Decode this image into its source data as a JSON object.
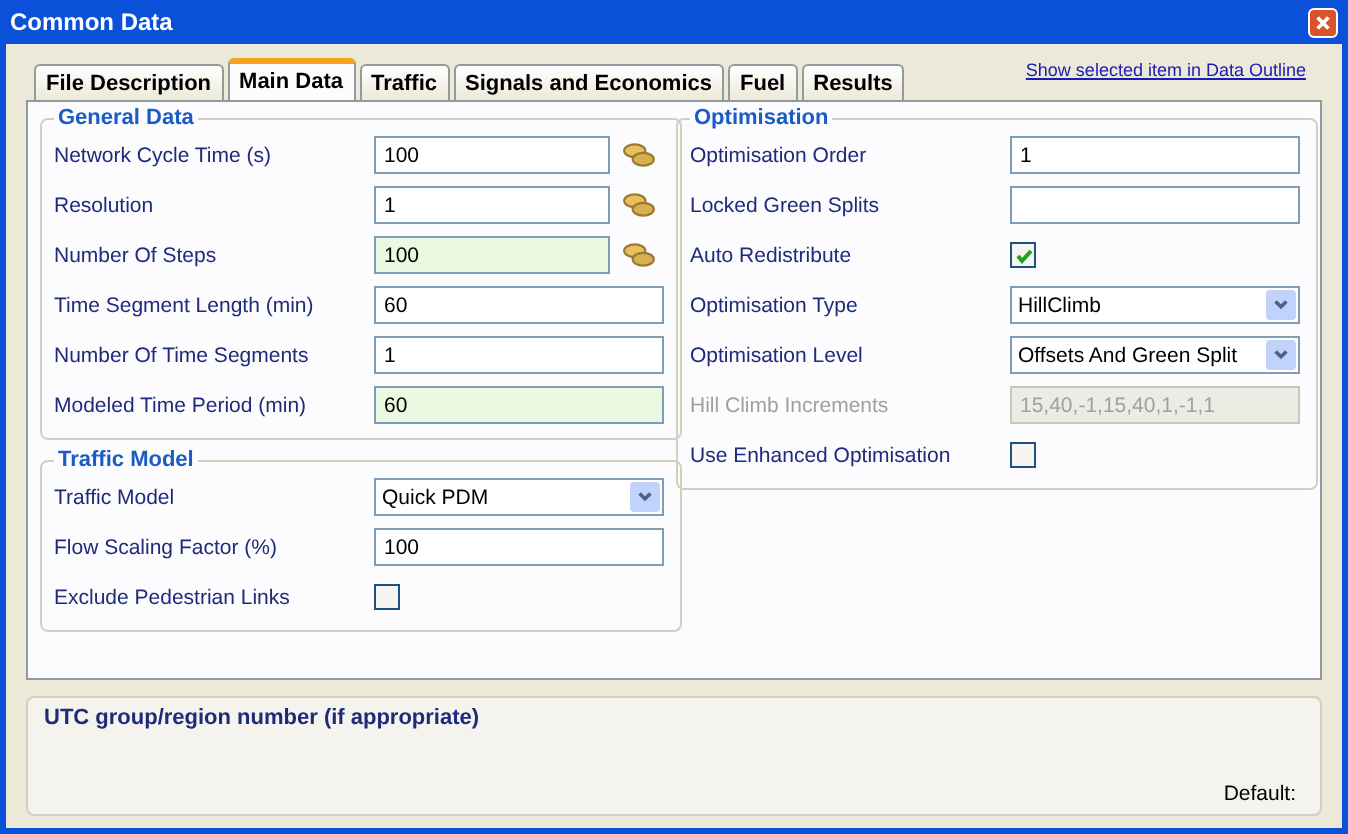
{
  "window": {
    "title": "Common Data"
  },
  "tabs": [
    {
      "label": "File Description",
      "selected": false
    },
    {
      "label": "Main Data",
      "selected": true
    },
    {
      "label": "Traffic",
      "selected": false
    },
    {
      "label": "Signals and Economics",
      "selected": false
    },
    {
      "label": "Fuel",
      "selected": false
    },
    {
      "label": "Results",
      "selected": false
    }
  ],
  "outline_link": "Show selected item in Data Outline",
  "left_groups": [
    {
      "title": "General Data",
      "rows": [
        {
          "kind": "text",
          "label": "Network Cycle Time (s)",
          "value": "100",
          "highlighted": false,
          "disabled": false,
          "has_lookup": true
        },
        {
          "kind": "text",
          "label": "Resolution",
          "value": "1",
          "highlighted": false,
          "disabled": false,
          "has_lookup": true
        },
        {
          "kind": "text",
          "label": "Number Of Steps",
          "value": "100",
          "highlighted": true,
          "disabled": false,
          "has_lookup": true
        },
        {
          "kind": "text",
          "label": "Time Segment Length (min)",
          "value": "60",
          "highlighted": false,
          "disabled": false,
          "has_lookup": false
        },
        {
          "kind": "text",
          "label": "Number Of Time Segments",
          "value": "1",
          "highlighted": false,
          "disabled": false,
          "has_lookup": false
        },
        {
          "kind": "text",
          "label": "Modeled Time Period (min)",
          "value": "60",
          "highlighted": true,
          "disabled": false,
          "has_lookup": false
        }
      ]
    },
    {
      "title": "Traffic Model",
      "rows": [
        {
          "kind": "select",
          "label": "Traffic Model",
          "value": "Quick PDM",
          "disabled": false
        },
        {
          "kind": "text",
          "label": "Flow Scaling Factor (%)",
          "value": "100",
          "highlighted": false,
          "disabled": false,
          "has_lookup": false
        },
        {
          "kind": "checkbox",
          "label": "Exclude Pedestrian Links",
          "checked": false,
          "disabled": false
        }
      ]
    }
  ],
  "right_groups": [
    {
      "title": "Optimisation",
      "rows": [
        {
          "kind": "text",
          "label": "Optimisation Order",
          "value": "1",
          "highlighted": false,
          "disabled": false,
          "has_lookup": false
        },
        {
          "kind": "text",
          "label": "Locked Green Splits",
          "highlighted": false,
          "disabled": false,
          "has_lookup": false
        },
        {
          "kind": "checkbox",
          "label": "Auto Redistribute",
          "checked": true,
          "disabled": false
        },
        {
          "kind": "select",
          "label": "Optimisation Type",
          "value": "HillClimb",
          "disabled": false
        },
        {
          "kind": "select",
          "label": "Optimisation Level",
          "value": "Offsets And Green Split",
          "disabled": false
        },
        {
          "kind": "text",
          "label": "Hill Climb Increments",
          "value": "15,40,-1,15,40,1,-1,1",
          "highlighted": false,
          "disabled": true,
          "has_lookup": false
        },
        {
          "kind": "checkbox",
          "label": "Use Enhanced Optimisation",
          "checked": false,
          "disabled": false
        }
      ]
    }
  ],
  "help": {
    "title": "UTC group/region number (if appropriate)",
    "default_label": "Default:"
  }
}
